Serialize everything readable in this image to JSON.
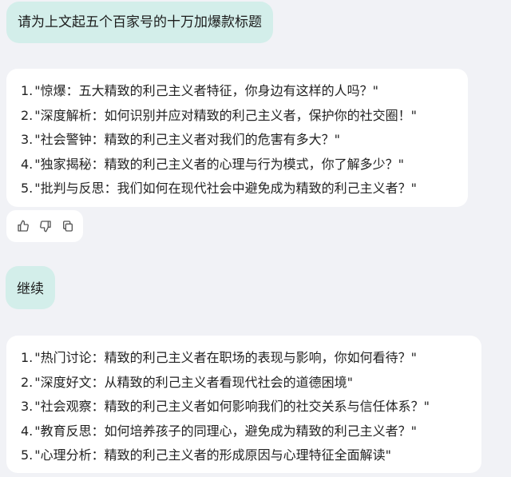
{
  "conversation": {
    "user_message_1": "请为上文起五个百家号的十万加爆款标题",
    "reply_1": [
      {
        "num": "1.",
        "text": "\"惊爆：五大精致的利己主义者特征，你身边有这样的人吗？\""
      },
      {
        "num": "2.",
        "text": "\"深度解析：如何识别并应对精致的利己主义者，保护你的社交圈！\""
      },
      {
        "num": "3.",
        "text": "\"社会警钟：精致的利己主义者对我们的危害有多大？\""
      },
      {
        "num": "4.",
        "text": "\"独家揭秘：精致的利己主义者的心理与行为模式，你了解多少？\""
      },
      {
        "num": "5.",
        "text": "\"批判与反思：我们如何在现代社会中避免成为精致的利己主义者？\""
      }
    ],
    "user_message_2": "继续",
    "reply_2": [
      {
        "num": "1.",
        "text": "\"热门讨论：精致的利己主义者在职场的表现与影响，你如何看待？\""
      },
      {
        "num": "2.",
        "text": "\"深度好文：从精致的利己主义者看现代社会的道德困境\""
      },
      {
        "num": "3.",
        "text": "\"社会观察：精致的利己主义者如何影响我们的社交关系与信任体系？\""
      },
      {
        "num": "4.",
        "text": "\"教育反思：如何培养孩子的同理心，避免成为精致的利己主义者？\""
      },
      {
        "num": "5.",
        "text": "\"心理分析：精致的利己主义者的形成原因与心理特征全面解读\""
      }
    ]
  },
  "actions": {
    "icons": [
      "thumbs-up-icon",
      "thumbs-down-icon",
      "copy-icon"
    ]
  },
  "colors": {
    "background": "#f1f2f6",
    "user_bubble": "#d3eeea",
    "card": "#ffffff",
    "icon": "#555555"
  }
}
